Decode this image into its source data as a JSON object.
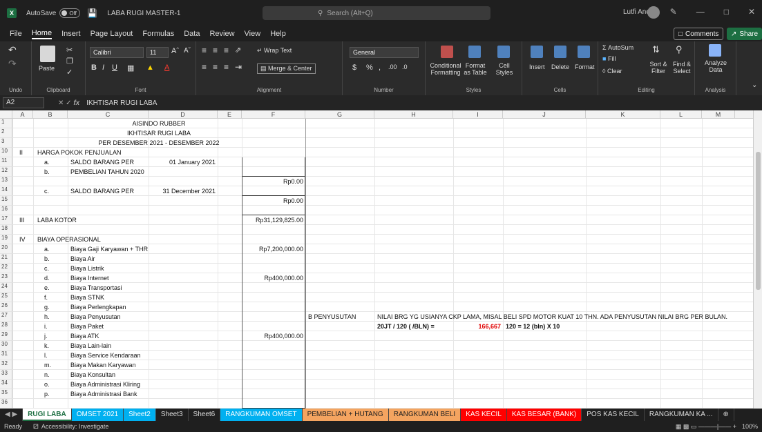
{
  "app": {
    "autosave_label": "AutoSave",
    "autosave_state": "Off",
    "doc_title": "LABA RUGI MASTER-1",
    "search_placeholder": "Search (Alt+Q)",
    "user_name": "Lutfi Andi"
  },
  "menu": [
    "File",
    "Home",
    "Insert",
    "Page Layout",
    "Formulas",
    "Data",
    "Review",
    "View",
    "Help"
  ],
  "menu_active": "Home",
  "comments_label": "Comments",
  "share_label": "Share",
  "ribbon": {
    "undo": "Undo",
    "clipboard": "Clipboard",
    "paste": "Paste",
    "font": "Font",
    "font_name": "Calibri",
    "font_size": "11",
    "alignment": "Alignment",
    "wrap_text": "Wrap Text",
    "merge_center": "Merge & Center",
    "number": "Number",
    "number_format": "General",
    "styles": "Styles",
    "cond_fmt": "Conditional Formatting",
    "fmt_table": "Format as Table",
    "cell_styles": "Cell Styles",
    "cells": "Cells",
    "insert": "Insert",
    "delete": "Delete",
    "format": "Format",
    "editing": "Editing",
    "autosum": "AutoSum",
    "fill": "Fill",
    "clear": "Clear",
    "sort_filter": "Sort & Filter",
    "find_select": "Find & Select",
    "analysis": "Analysis",
    "analyze_data": "Analyze Data"
  },
  "formula_bar": {
    "name_box": "A2",
    "value": "IKHTISAR RUGI LABA"
  },
  "columns": [
    "A",
    "B",
    "C",
    "D",
    "E",
    "F",
    "G",
    "H",
    "I",
    "J",
    "K",
    "L",
    "M"
  ],
  "rows": [
    "1",
    "2",
    "3",
    "10",
    "11",
    "12",
    "13",
    "14",
    "15",
    "16",
    "17",
    "18",
    "19",
    "20",
    "21",
    "22",
    "23",
    "24",
    "25",
    "26",
    "27",
    "28",
    "29",
    "30",
    "31",
    "32",
    "33",
    "34",
    "35",
    "36"
  ],
  "cells": {
    "title1": "AISINDO RUBBER",
    "title2": "IKHTISAR RUGI LABA",
    "title3": "PER DESEMBER 2021 - DESEMBER 2022",
    "r10a": "II",
    "r10b": "HARGA POKOK PENJUALAN",
    "r11b": "a.",
    "r11c": "SALDO BARANG PER",
    "r11d": "01 January 2021",
    "r12b": "b.",
    "r12c": "PEMBELIAN TAHUN 2020",
    "r13f": "Rp0.00",
    "r14b": "c.",
    "r14c": "SALDO BARANG PER",
    "r14d": "31 December 2021",
    "r15f": "Rp0.00",
    "r17a": "III",
    "r17b": "LABA KOTOR",
    "r17f": "Rp31,129,825.00",
    "r19a": "IV",
    "r19b": "BIAYA OPERASIONAL",
    "r20b": "a.",
    "r20c": "Biaya Gaji Karyawan + THR",
    "r20f": "Rp7,200,000.00",
    "r21b": "b.",
    "r21c": "Biaya Air",
    "r22b": "c.",
    "r22c": "Biaya Listrik",
    "r23b": "d.",
    "r23c": "Biaya Internet",
    "r23f": "Rp400,000.00",
    "r24b": "e.",
    "r24c": "Biaya Transportasi",
    "r25b": "f.",
    "r25c": "Biaya STNK",
    "r26b": "g.",
    "r26c": "Biaya Perlengkapan",
    "r27b": "h.",
    "r27c": "Biaya Penyusutan",
    "r27g": "B PENYUSUTAN",
    "r27h": "NILAI BRG YG USIANYA CKP LAMA, MISAL BELI SPD MOTOR KUAT 10 THN. ADA PENYUSUTAN NILAI BRG PER BULAN.",
    "r28b": "i.",
    "r28c": "Biaya Paket",
    "r28h": "20JT / 120 ( /BLN) =",
    "r28i": "166,667",
    "r28j": "120 = 12 (bln) X 10",
    "r29b": "j.",
    "r29c": "Biaya ATK",
    "r29f": "Rp400,000.00",
    "r30b": "k.",
    "r30c": "Biaya Lain-lain",
    "r31b": "l.",
    "r31c": "Biaya Service Kendaraan",
    "r32b": "m.",
    "r32c": "Biaya Makan Karyawan",
    "r33b": "n.",
    "r33c": "Biaya Konsultan",
    "r34b": "o.",
    "r34c": "Biaya Administrasi Kliring",
    "r35b": "p.",
    "r35c": "Biaya Administrasi Bank"
  },
  "tabs": [
    {
      "label": "RUGI LABA",
      "bg": "#ffffff",
      "fg": "#1d6f42"
    },
    {
      "label": "OMSET 2021",
      "bg": "#00b0f0",
      "fg": "#ffffff"
    },
    {
      "label": "Sheet2",
      "bg": "#00b0f0",
      "fg": "#ffffff"
    },
    {
      "label": "Sheet3",
      "bg": "#1f1f1f",
      "fg": "#dddddd"
    },
    {
      "label": "Sheet6",
      "bg": "#1f1f1f",
      "fg": "#dddddd"
    },
    {
      "label": "RANGKUMAN OMSET",
      "bg": "#00b0f0",
      "fg": "#ffffff"
    },
    {
      "label": "PEMBELIAN + HUTANG",
      "bg": "#f4a460",
      "fg": "#222222"
    },
    {
      "label": "RANGKUMAN BELI",
      "bg": "#f4a460",
      "fg": "#222222"
    },
    {
      "label": "KAS KECIL",
      "bg": "#ff0000",
      "fg": "#ffffff"
    },
    {
      "label": "KAS BESAR (BANK)",
      "bg": "#ff0000",
      "fg": "#ffffff"
    },
    {
      "label": "POS KAS KECIL",
      "bg": "#1f1f1f",
      "fg": "#dddddd"
    },
    {
      "label": "RANGKUMAN KA ...",
      "bg": "#1f1f1f",
      "fg": "#dddddd"
    }
  ],
  "status": {
    "ready": "Ready",
    "accessibility": "Accessibility: Investigate",
    "zoom": "100%"
  }
}
